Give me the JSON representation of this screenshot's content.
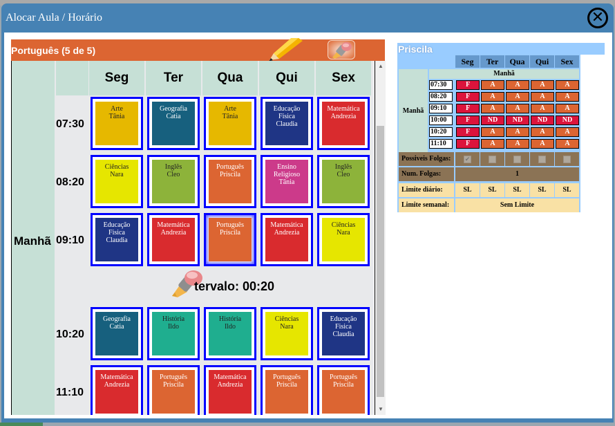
{
  "dialog": {
    "title": "Alocar Aula / Horário",
    "close_icon": "close-circle-icon"
  },
  "lesson_bar": {
    "title": "Português (5 de 5)",
    "pencil_icon": "pencil-icon",
    "eraser_icon": "eraser-icon",
    "color": "#dc6532"
  },
  "schedule": {
    "turno": "Manhã",
    "days": [
      "Seg",
      "Ter",
      "Qua",
      "Qui",
      "Sex"
    ],
    "interval": "Intervalo: 00:20",
    "interval_visible": "tervalo: 00:20",
    "rows": [
      {
        "time": "07:30",
        "cells": [
          {
            "subject": "Arte",
            "teacher": "Tânia",
            "color": "#e6b800",
            "text": "#222"
          },
          {
            "subject": "Geografia",
            "teacher": "Catia",
            "color": "#17607e",
            "text": "#fff"
          },
          {
            "subject": "Arte",
            "teacher": "Tânia",
            "color": "#e6b800",
            "text": "#222"
          },
          {
            "subject": "Educação",
            "subject2": "Fisica",
            "teacher": "Claudia",
            "color": "#1f3585",
            "text": "#fff"
          },
          {
            "subject": "Matemática",
            "teacher": "Andrezia",
            "color": "#d92b2e",
            "text": "#fff"
          }
        ]
      },
      {
        "time": "08:20",
        "cells": [
          {
            "subject": "Ciências",
            "teacher": "Nara",
            "color": "#e6e600",
            "text": "#222"
          },
          {
            "subject": "Inglês",
            "teacher": "Cleo",
            "color": "#8db33a",
            "text": "#222"
          },
          {
            "subject": "Português",
            "teacher": "Priscila",
            "color": "#dc6532",
            "text": "#fff"
          },
          {
            "subject": "Ensino",
            "subject2": "Religioso",
            "teacher": "Tânia",
            "color": "#cc3a8a",
            "text": "#fff"
          },
          {
            "subject": "Inglês",
            "teacher": "Cleo",
            "color": "#8db33a",
            "text": "#222"
          }
        ]
      },
      {
        "time": "09:10",
        "cells": [
          {
            "subject": "Educação",
            "subject2": "Fisica",
            "teacher": "Claudia",
            "color": "#1f3585",
            "text": "#fff"
          },
          {
            "subject": "Matemática",
            "teacher": "Andrezia",
            "color": "#d92b2e",
            "text": "#fff"
          },
          {
            "subject": "Português",
            "teacher": "Priscila",
            "color": "#dc6532",
            "text": "#fff",
            "selected": true
          },
          {
            "subject": "Matemática",
            "teacher": "Andrezia",
            "color": "#d92b2e",
            "text": "#fff"
          },
          {
            "subject": "Ciências",
            "teacher": "Nara",
            "color": "#e6e600",
            "text": "#222"
          }
        ]
      },
      {
        "time": "10:20",
        "cells": [
          {
            "subject": "Geografia",
            "teacher": "Catia",
            "color": "#17607e",
            "text": "#fff"
          },
          {
            "subject": "História",
            "teacher": "Ildo",
            "color": "#1fae8f",
            "text": "#222"
          },
          {
            "subject": "História",
            "teacher": "Ildo",
            "color": "#1fae8f",
            "text": "#222"
          },
          {
            "subject": "Ciências",
            "teacher": "Nara",
            "color": "#e6e600",
            "text": "#222"
          },
          {
            "subject": "Educação",
            "subject2": "Fisica",
            "teacher": "Claudia",
            "color": "#1f3585",
            "text": "#fff"
          }
        ]
      },
      {
        "time": "11:10",
        "cells": [
          {
            "subject": "Matemática",
            "teacher": "Andrezia",
            "color": "#d92b2e",
            "text": "#fff"
          },
          {
            "subject": "Português",
            "teacher": "Priscila",
            "color": "#dc6532",
            "text": "#fff"
          },
          {
            "subject": "Matemática",
            "teacher": "Andrezia",
            "color": "#d92b2e",
            "text": "#fff"
          },
          {
            "subject": "Português",
            "teacher": "Priscila",
            "color": "#dc6532",
            "text": "#fff"
          },
          {
            "subject": "Português",
            "teacher": "Priscila",
            "color": "#dc6532",
            "text": "#fff"
          }
        ]
      }
    ]
  },
  "teacher_panel": {
    "name": "Priscila",
    "days": [
      "Seg",
      "Ter",
      "Qua",
      "Qui",
      "Sex"
    ],
    "turno": "Manhã",
    "turno_header": "Manhã",
    "rows": [
      {
        "time": "07:30",
        "status": [
          "F",
          "A",
          "A",
          "A",
          "A"
        ]
      },
      {
        "time": "08:20",
        "status": [
          "F",
          "A",
          "A",
          "A",
          "A"
        ]
      },
      {
        "time": "09:10",
        "status": [
          "F",
          "A",
          "A",
          "A",
          "A"
        ]
      },
      {
        "time": "10:00",
        "status": [
          "F",
          "ND",
          "ND",
          "ND",
          "ND"
        ]
      },
      {
        "time": "10:20",
        "status": [
          "F",
          "A",
          "A",
          "A",
          "A"
        ]
      },
      {
        "time": "11:10",
        "status": [
          "F",
          "A",
          "A",
          "A",
          "A"
        ]
      }
    ],
    "possiveis_folgas_label": "Possiveis Folgas:",
    "possiveis_folgas": [
      true,
      false,
      false,
      false,
      false
    ],
    "num_folgas_label": "Num. Folgas:",
    "num_folgas": "1",
    "limite_diario_label": "Limite diário:",
    "limite_diario": [
      "SL",
      "SL",
      "SL",
      "SL",
      "SL"
    ],
    "limite_semanal_label": "Limite semanal:",
    "limite_semanal": "Sem Limite"
  }
}
